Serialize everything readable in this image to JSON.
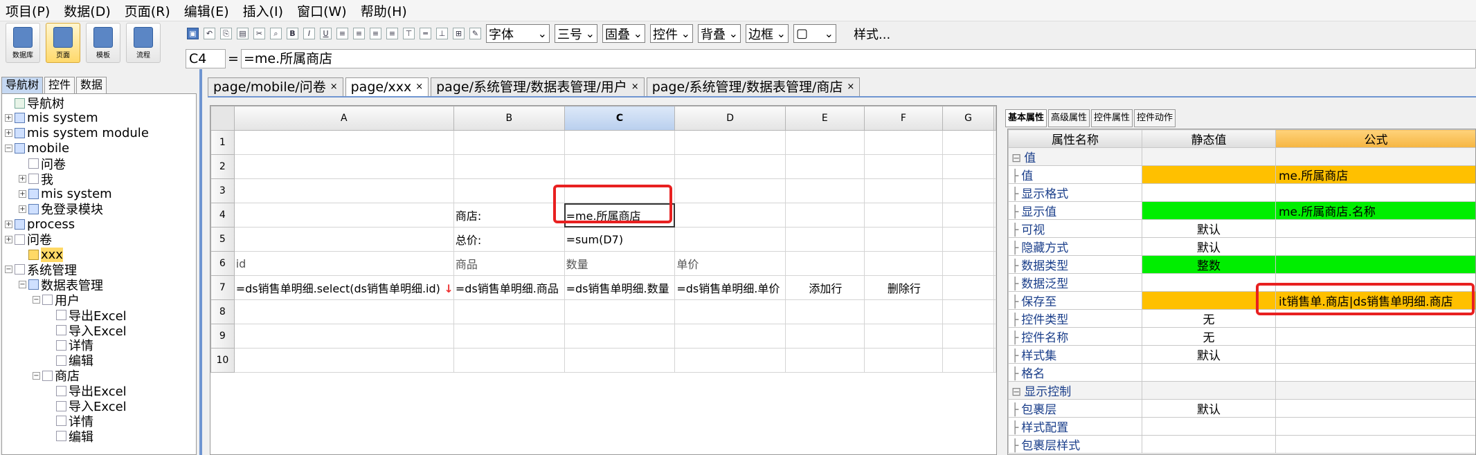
{
  "menu": [
    "项目(P)",
    "数据(D)",
    "页面(R)",
    "编辑(E)",
    "插入(I)",
    "窗口(W)",
    "帮助(H)"
  ],
  "big_tools": [
    {
      "label": "数据库",
      "icon": "database-icon",
      "active": false
    },
    {
      "label": "页面",
      "icon": "page-icon",
      "active": true
    },
    {
      "label": "模板",
      "icon": "template-icon",
      "active": false
    },
    {
      "label": "流程",
      "icon": "flow-icon",
      "active": false
    }
  ],
  "toolbar": {
    "font_select": "字体",
    "size_select": "三号",
    "select3": "固叠",
    "select4": "控件",
    "select5": "背叠",
    "select6": "边框",
    "style_label": "样式..."
  },
  "formula": {
    "cell_ref": "C4",
    "eq": "=",
    "value": "=me.所属商店"
  },
  "left_tabs": [
    "导航树",
    "控件",
    "数据"
  ],
  "tree": [
    {
      "label": "导航树",
      "indent": 0,
      "expander": "",
      "icon": "nav-root"
    },
    {
      "label": "mis system",
      "indent": 0,
      "expander": "+",
      "icon": "page"
    },
    {
      "label": "mis system module",
      "indent": 0,
      "expander": "+",
      "icon": "page"
    },
    {
      "label": "mobile",
      "indent": 0,
      "expander": "−",
      "icon": "page"
    },
    {
      "label": "问卷",
      "indent": 1,
      "expander": "",
      "icon": "doc"
    },
    {
      "label": "我",
      "indent": 1,
      "expander": "+",
      "icon": "doc"
    },
    {
      "label": "mis system",
      "indent": 1,
      "expander": "+",
      "icon": "page"
    },
    {
      "label": "免登录模块",
      "indent": 1,
      "expander": "+",
      "icon": "page"
    },
    {
      "label": "process",
      "indent": 0,
      "expander": "+",
      "icon": "page"
    },
    {
      "label": "问卷",
      "indent": 0,
      "expander": "+",
      "icon": "doc"
    },
    {
      "label": "xxx",
      "indent": 1,
      "expander": "",
      "icon": "sel",
      "highlight": true
    },
    {
      "label": "系统管理",
      "indent": 0,
      "expander": "−",
      "icon": "doc"
    },
    {
      "label": "数据表管理",
      "indent": 1,
      "expander": "−",
      "icon": "page"
    },
    {
      "label": "用户",
      "indent": 2,
      "expander": "−",
      "icon": "doc"
    },
    {
      "label": "导出Excel",
      "indent": 3,
      "expander": "",
      "icon": "doc"
    },
    {
      "label": "导入Excel",
      "indent": 3,
      "expander": "",
      "icon": "doc"
    },
    {
      "label": "详情",
      "indent": 3,
      "expander": "",
      "icon": "doc"
    },
    {
      "label": "编辑",
      "indent": 3,
      "expander": "",
      "icon": "doc"
    },
    {
      "label": "商店",
      "indent": 2,
      "expander": "−",
      "icon": "doc"
    },
    {
      "label": "导出Excel",
      "indent": 3,
      "expander": "",
      "icon": "doc"
    },
    {
      "label": "导入Excel",
      "indent": 3,
      "expander": "",
      "icon": "doc"
    },
    {
      "label": "详情",
      "indent": 3,
      "expander": "",
      "icon": "doc"
    },
    {
      "label": "编辑",
      "indent": 3,
      "expander": "",
      "icon": "doc"
    }
  ],
  "doc_tabs": [
    {
      "label": "page/mobile/问卷",
      "active": false
    },
    {
      "label": "page/xxx",
      "active": true
    },
    {
      "label": "page/系统管理/数据表管理/用户",
      "active": false
    },
    {
      "label": "page/系统管理/数据表管理/商店",
      "active": false
    }
  ],
  "sheet": {
    "columns": [
      "A",
      "B",
      "C",
      "D",
      "E",
      "F",
      "G"
    ],
    "selected_col": "C",
    "rows": [
      {
        "n": "1",
        "cells": [
          "",
          "",
          "",
          "",
          "",
          "",
          ""
        ]
      },
      {
        "n": "2",
        "cells": [
          "",
          "",
          "",
          "",
          "",
          "",
          ""
        ]
      },
      {
        "n": "3",
        "cells": [
          "",
          "",
          "",
          "",
          "",
          "",
          ""
        ]
      },
      {
        "n": "4",
        "cells": [
          "",
          "商店:",
          "=me.所属商店",
          "",
          "",
          "",
          ""
        ]
      },
      {
        "n": "5",
        "cells": [
          "",
          "总价:",
          "=sum(D7)",
          "",
          "",
          "",
          ""
        ]
      },
      {
        "n": "6",
        "cells": [
          "id",
          "商品",
          "数量",
          "单价",
          "",
          "",
          ""
        ]
      },
      {
        "n": "7",
        "cells": [
          "=ds销售单明细.select(ds销售单明细.id)",
          "=ds销售单明细.商品",
          "=ds销售单明细.数量",
          "=ds销售单明细.单价",
          "添加行",
          "删除行",
          ""
        ]
      },
      {
        "n": "8",
        "cells": [
          "",
          "",
          "",
          "",
          "",
          "",
          ""
        ]
      },
      {
        "n": "9",
        "cells": [
          "",
          "",
          "",
          "",
          "",
          "",
          ""
        ]
      },
      {
        "n": "10",
        "cells": [
          "",
          "",
          "",
          "",
          "",
          "",
          ""
        ]
      }
    ]
  },
  "prop_tabs": [
    "基本属性",
    "高级属性",
    "控件属性",
    "控件动作"
  ],
  "prop_headers": [
    "属性名称",
    "静态值",
    "公式"
  ],
  "props": [
    {
      "name": "值",
      "group": true,
      "static": "",
      "formula": ""
    },
    {
      "name": "值",
      "static": "",
      "formula": "me.所属商店",
      "static_color": "orange",
      "formula_color": "orange"
    },
    {
      "name": "显示格式",
      "static": "",
      "formula": ""
    },
    {
      "name": "显示值",
      "static": "",
      "formula": "me.所属商店.名称",
      "static_color": "green",
      "formula_color": "green"
    },
    {
      "name": "可视",
      "static": "默认",
      "formula": ""
    },
    {
      "name": "隐藏方式",
      "static": "默认",
      "formula": ""
    },
    {
      "name": "数据类型",
      "static": "整数",
      "formula": "",
      "static_color": "green",
      "formula_color": "green"
    },
    {
      "name": "数据泛型",
      "static": "",
      "formula": ""
    },
    {
      "name": "保存至",
      "static": "",
      "formula": "it销售单.商店|ds销售单明细.商店",
      "static_color": "orange",
      "formula_color": "orange"
    },
    {
      "name": "控件类型",
      "static": "无",
      "formula": ""
    },
    {
      "name": "控件名称",
      "static": "无",
      "formula": ""
    },
    {
      "name": "样式集",
      "static": "默认",
      "formula": ""
    },
    {
      "name": "格名",
      "static": "",
      "formula": ""
    },
    {
      "name": "显示控制",
      "group": true,
      "static": "",
      "formula": ""
    },
    {
      "name": "包裹层",
      "static": "默认",
      "formula": ""
    },
    {
      "name": "样式配置",
      "static": "",
      "formula": ""
    },
    {
      "name": "包裹层样式",
      "static": "",
      "formula": ""
    }
  ]
}
